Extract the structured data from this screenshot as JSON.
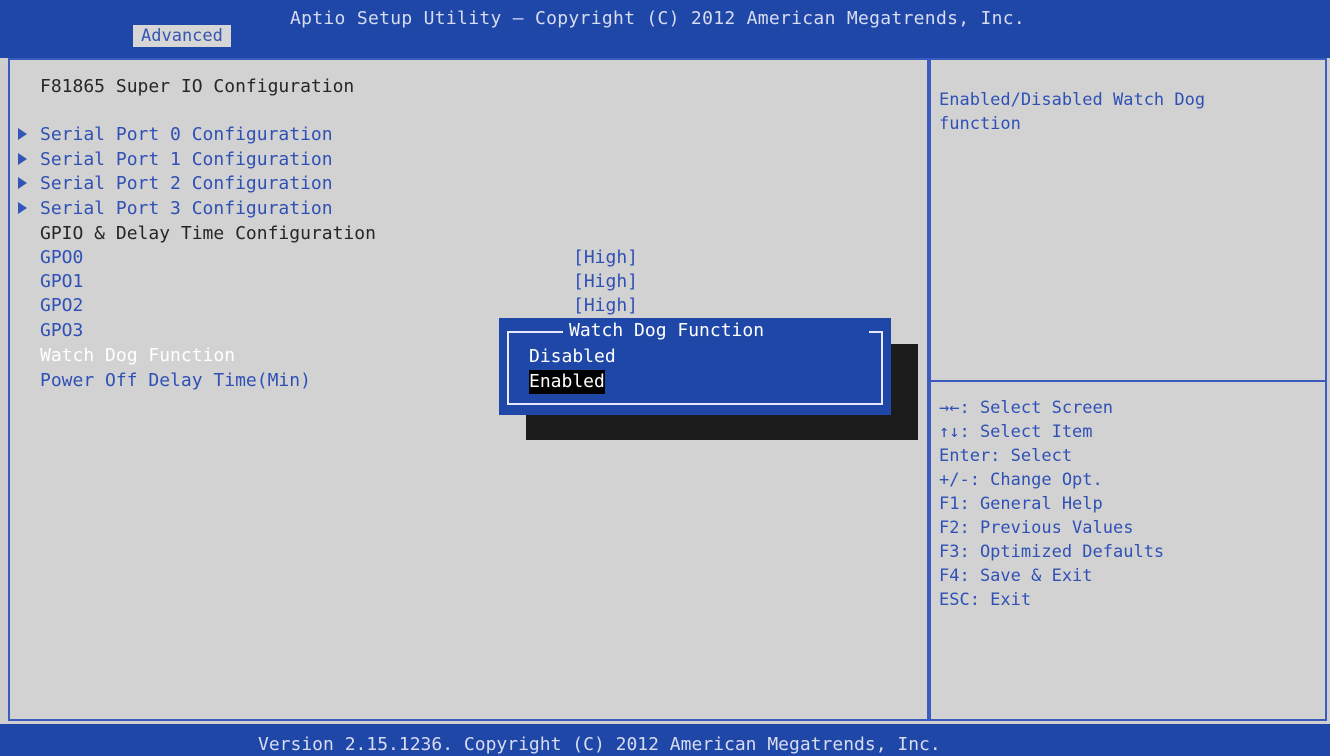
{
  "header": {
    "title": "Aptio Setup Utility – Copyright (C) 2012 American Megatrends, Inc.",
    "tab": "Advanced"
  },
  "main": {
    "heading": "F81865 Super IO Configuration",
    "submenus": [
      "Serial Port 0 Configuration",
      "Serial Port 1 Configuration",
      "Serial Port 2 Configuration",
      "Serial Port 3 Configuration"
    ],
    "section_label": "GPIO & Delay Time Configuration",
    "gpo_items": [
      {
        "label": "GPO0",
        "value": "[High]"
      },
      {
        "label": "GPO1",
        "value": "[High]"
      },
      {
        "label": "GPO2",
        "value": "[High]"
      },
      {
        "label": "GPO3",
        "value": ""
      }
    ],
    "watchdog_label": "Watch Dog Function",
    "power_off_label": "Power Off Delay Time(Min)"
  },
  "popup": {
    "title": "Watch Dog Function",
    "options": [
      "Disabled",
      "Enabled"
    ],
    "selected": "Enabled"
  },
  "help": {
    "description": "Enabled/Disabled Watch Dog\nfunction",
    "keys": [
      "→←: Select Screen",
      "↑↓: Select Item",
      "Enter: Select",
      "+/-: Change Opt.",
      "F1: General Help",
      "F2: Previous Values",
      "F3: Optimized Defaults",
      "F4: Save & Exit",
      "ESC: Exit"
    ]
  },
  "footer": {
    "text": "Version 2.15.1236. Copyright (C) 2012 American Megatrends, Inc."
  }
}
